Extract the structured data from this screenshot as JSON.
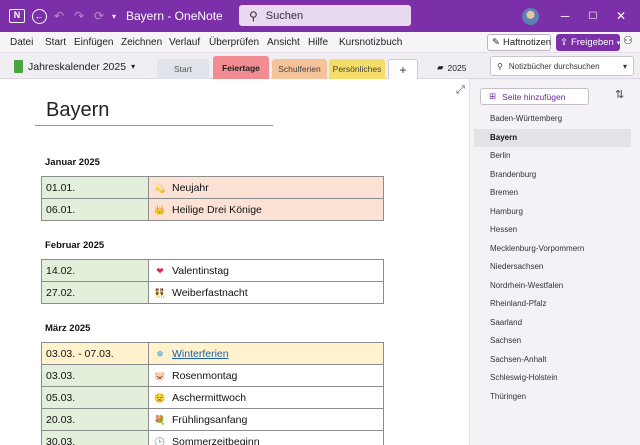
{
  "titlebar": {
    "app_icon": "onenote-icon",
    "app_letter": "N",
    "title": "Bayern  -  OneNote",
    "search_placeholder": "Suchen",
    "buttons": [
      "back-icon",
      "undo-icon",
      "redo-icon",
      "sync-icon",
      "quick-access-chevron-icon"
    ],
    "window_controls": [
      "─",
      "☐",
      "✕"
    ]
  },
  "menu": {
    "items": [
      "Datei",
      "Start",
      "Einfügen",
      "Zeichnen",
      "Verlauf",
      "Überprüfen",
      "Ansicht",
      "Hilfe",
      "Kursnotizbuch"
    ],
    "haftnotizen": "Haftnotizen",
    "freigeben": "Freigeben"
  },
  "notebook": {
    "name": "Jahreskalender 2025",
    "sections": [
      {
        "label": "Start",
        "color": "#e1e3ea"
      },
      {
        "label": "Feiertage",
        "color": "#f08c92",
        "active": true
      },
      {
        "label": "Schulferien",
        "color": "#f5c39a"
      },
      {
        "label": "Persönliches",
        "color": "#f5dd6a"
      }
    ],
    "add_section": "+",
    "section_group": "2025",
    "search_placeholder": "Notizbücher durchsuchen"
  },
  "page": {
    "title": "Bayern",
    "months": [
      {
        "name": "Januar 2025",
        "rows": [
          {
            "date": "01.01.",
            "event": "Neujahr",
            "emoji": "💫",
            "type": "holiday"
          },
          {
            "date": "06.01.",
            "event": "Heilige Drei Könige",
            "emoji": "👑",
            "type": "holiday"
          }
        ]
      },
      {
        "name": "Februar 2025",
        "rows": [
          {
            "date": "14.02.",
            "event": "Valentinstag",
            "emoji": "❤",
            "type": "normal"
          },
          {
            "date": "27.02.",
            "event": "Weiberfastnacht",
            "emoji": "👯",
            "type": "normal"
          }
        ]
      },
      {
        "name": "März 2025",
        "rows": [
          {
            "date": "03.03. - 07.03.",
            "event": "Winterferien",
            "emoji": "❄",
            "type": "vacation"
          },
          {
            "date": "03.03.",
            "event": "Rosenmontag",
            "emoji": "🐷",
            "type": "normal"
          },
          {
            "date": "05.03.",
            "event": "Aschermittwoch",
            "emoji": "😟",
            "type": "normal"
          },
          {
            "date": "20.03.",
            "event": "Frühlingsanfang",
            "emoji": "💐",
            "type": "normal"
          },
          {
            "date": "30.03.",
            "event": "Sommerzeitbeginn",
            "emoji": "🕒",
            "type": "normal"
          }
        ]
      }
    ]
  },
  "pagelist": {
    "add_page": "Seite hinzufügen",
    "pages": [
      "Baden-Württemberg",
      "Bayern",
      "Berlin",
      "Brandenburg",
      "Bremen",
      "Hamburg",
      "Hessen",
      "Mecklenburg-Vorpommern",
      "Niedersachsen",
      "Nordrhein-Westfalen",
      "Rheinland-Pfalz",
      "Saarland",
      "Sachsen",
      "Sachsen-Anhalt",
      "Schleswig-Holstein",
      "Thüringen"
    ],
    "selected": "Bayern"
  }
}
